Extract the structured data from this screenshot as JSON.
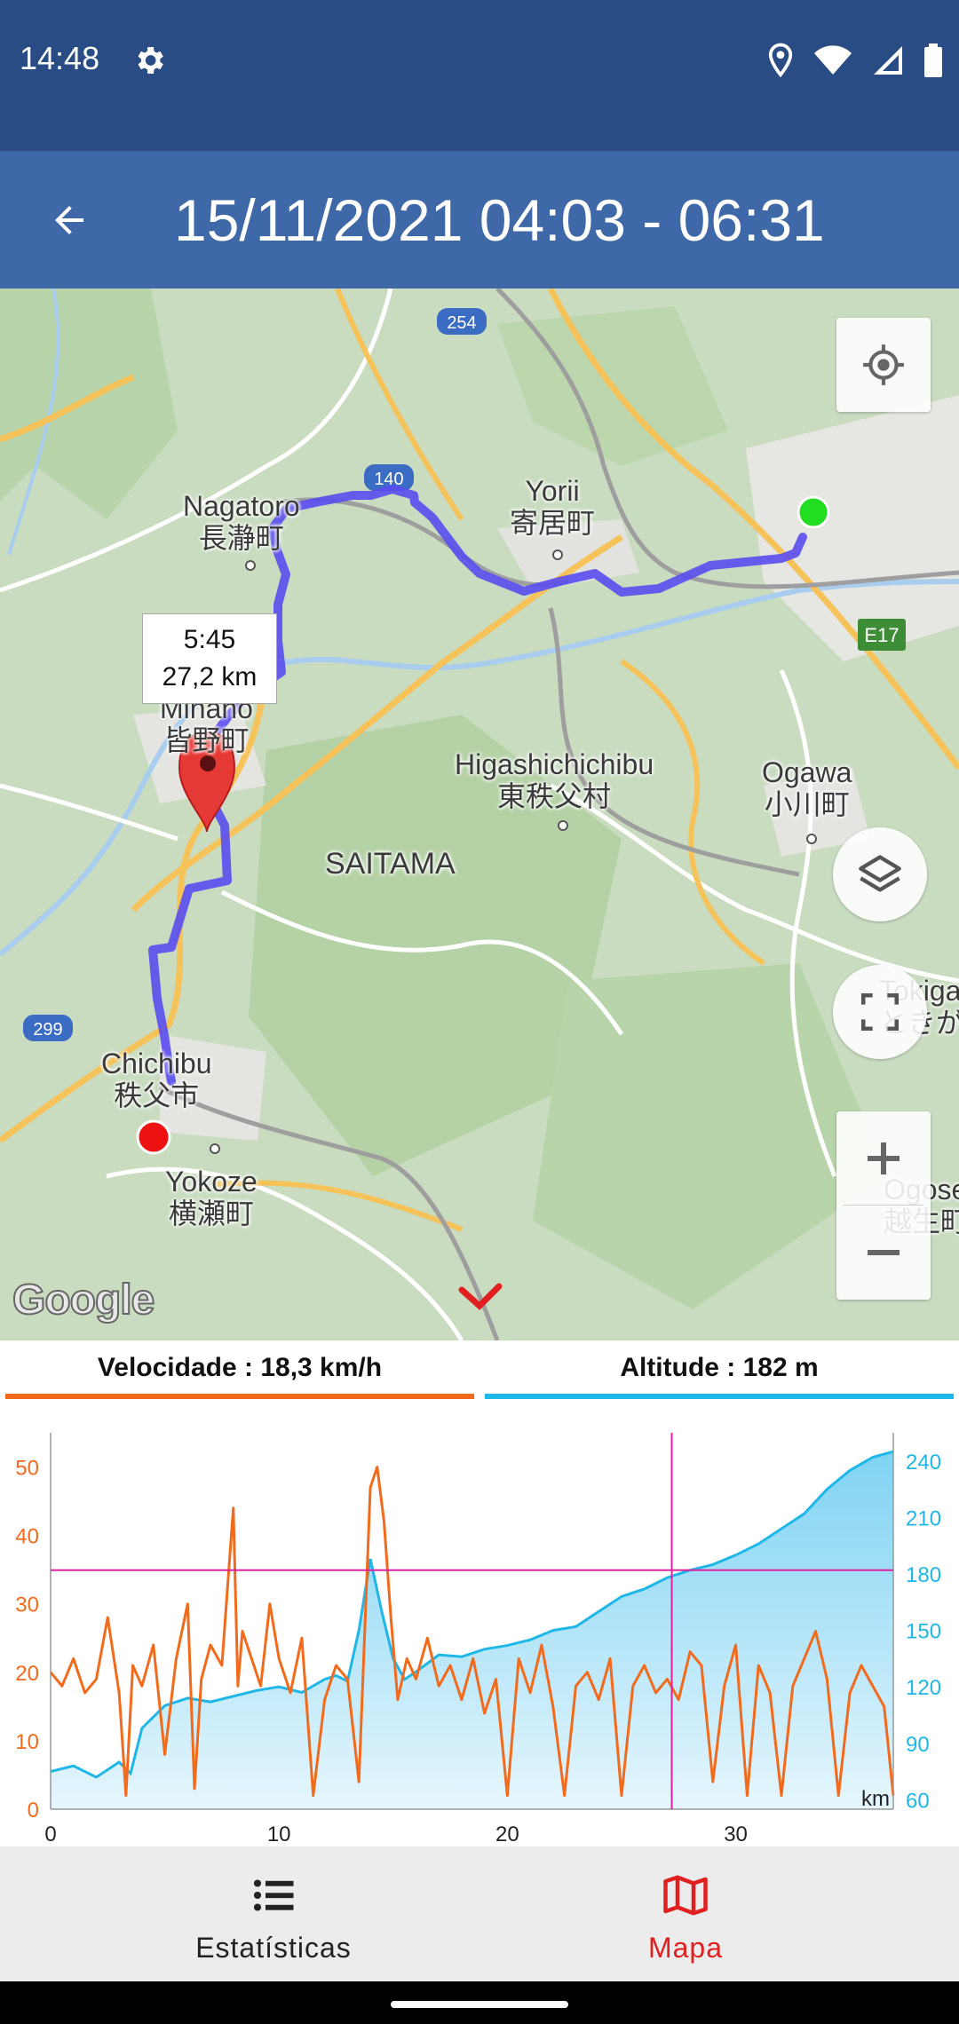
{
  "status_bar": {
    "time": "14:48",
    "icons": [
      "gear-icon",
      "location-icon",
      "wifi-icon",
      "signal-icon",
      "battery-icon"
    ]
  },
  "app_bar": {
    "back_icon": "arrow-left-icon",
    "title": "15/11/2021 04:03 - 06:31"
  },
  "map": {
    "labels": {
      "nagatoro": "Nagatoro\n長瀞町",
      "yorii": "Yorii\n寄居町",
      "minano": "Minano\n皆野町",
      "higashichichibu": "Higashichichibu\n東秩父村",
      "ogawa": "Ogawa\n小川町",
      "saitama": "SAITAMA",
      "chichibu": "Chichibu\n秩父市",
      "yokoze": "Yokoze\n横瀬町",
      "tokigawa": "Tokigawa\nときがわ",
      "ogose": "Ogose\n越生町"
    },
    "road_shields": [
      "254",
      "140",
      "299",
      "E17"
    ],
    "tooltip": {
      "time": "5:45",
      "distance": "27,2 km"
    },
    "google_logo": "Google",
    "buttons": {
      "my_location": "crosshair-icon",
      "layers": "layers-icon",
      "fullscreen": "fullscreen-icon",
      "zoom_in": "plus-icon",
      "zoom_out": "minus-icon"
    },
    "colors": {
      "track": "#5a4df0",
      "start": "#22dd22",
      "end": "#ee1111",
      "pin": "#e53935"
    }
  },
  "metrics": {
    "speed_label": "Velocidade : 18,3 km/h",
    "altitude_label": "Altitude : 182 m",
    "speed_color": "#f26b1d",
    "altitude_color": "#1fb6e8"
  },
  "chart_data": {
    "type": "line",
    "x_ticks": [
      "0",
      "10",
      "20",
      "30"
    ],
    "x_unit": "km",
    "xlim": [
      0,
      36.9
    ],
    "cursor_x": 27.2,
    "left_axis": {
      "ticks": [
        "0",
        "10",
        "20",
        "30",
        "40",
        "50"
      ],
      "ylim": [
        0,
        55
      ]
    },
    "right_axis": {
      "ticks": [
        "60",
        "90",
        "120",
        "150",
        "180",
        "210",
        "240"
      ],
      "ylim": [
        55,
        255
      ]
    },
    "series": [
      {
        "name": "Velocidade",
        "axis": "left",
        "x": [
          0,
          0.5,
          1,
          1.5,
          2,
          2.5,
          3,
          3.3,
          3.6,
          4,
          4.5,
          5,
          5.5,
          6,
          6.3,
          6.6,
          7,
          7.5,
          8,
          8.2,
          8.4,
          8.8,
          9.2,
          9.6,
          10,
          10.5,
          11,
          11.5,
          12,
          12.5,
          13,
          13.5,
          14,
          14.3,
          14.6,
          14.9,
          15.2,
          15.6,
          16,
          16.5,
          17,
          17.5,
          18,
          18.5,
          19,
          19.5,
          20,
          20.5,
          21,
          21.5,
          22,
          22.5,
          23,
          23.5,
          24,
          24.5,
          25,
          25.5,
          26,
          26.5,
          27,
          27.5,
          28,
          28.5,
          29,
          29.5,
          30,
          30.5,
          31,
          31.5,
          32,
          32.5,
          33,
          33.5,
          34,
          34.5,
          35,
          35.5,
          36,
          36.5,
          36.9
        ],
        "y": [
          20,
          18,
          22,
          17,
          19,
          28,
          17,
          2,
          21,
          18,
          24,
          8,
          22,
          30,
          3,
          19,
          24,
          21,
          44,
          18,
          26,
          22,
          18,
          30,
          22,
          17,
          25,
          2,
          16,
          21,
          19,
          4,
          47,
          50,
          42,
          28,
          16,
          22,
          19,
          25,
          18,
          21,
          16,
          22,
          14,
          19,
          2,
          22,
          17,
          24,
          15,
          2,
          18,
          20,
          16,
          22,
          2,
          18,
          21,
          17,
          19,
          16,
          23,
          21,
          4,
          18,
          24,
          2,
          21,
          17,
          2,
          18,
          22,
          26,
          19,
          2,
          17,
          21,
          18,
          15,
          2
        ]
      },
      {
        "name": "Altitude",
        "axis": "right",
        "x": [
          0,
          1,
          2,
          3,
          3.5,
          4,
          5,
          6,
          7,
          8,
          9,
          10,
          11,
          12,
          12.5,
          13,
          13.5,
          14,
          14.5,
          15,
          15.5,
          16,
          17,
          18,
          19,
          20,
          21,
          22,
          23,
          24,
          25,
          26,
          27,
          28,
          29,
          30,
          31,
          32,
          33,
          34,
          35,
          36,
          36.9
        ],
        "y": [
          75,
          78,
          72,
          80,
          74,
          98,
          110,
          114,
          112,
          115,
          118,
          120,
          117,
          124,
          126,
          123,
          150,
          188,
          160,
          135,
          124,
          128,
          137,
          136,
          140,
          142,
          145,
          150,
          152,
          160,
          168,
          172,
          178,
          182,
          185,
          190,
          196,
          204,
          212,
          225,
          235,
          242,
          245
        ]
      }
    ]
  },
  "bottom_nav": {
    "items": [
      {
        "label": "Estatísticas",
        "icon": "list-icon",
        "active": false
      },
      {
        "label": "Mapa",
        "icon": "map-icon",
        "active": true
      }
    ],
    "active_color": "#e02020",
    "inactive_color": "#222222"
  }
}
